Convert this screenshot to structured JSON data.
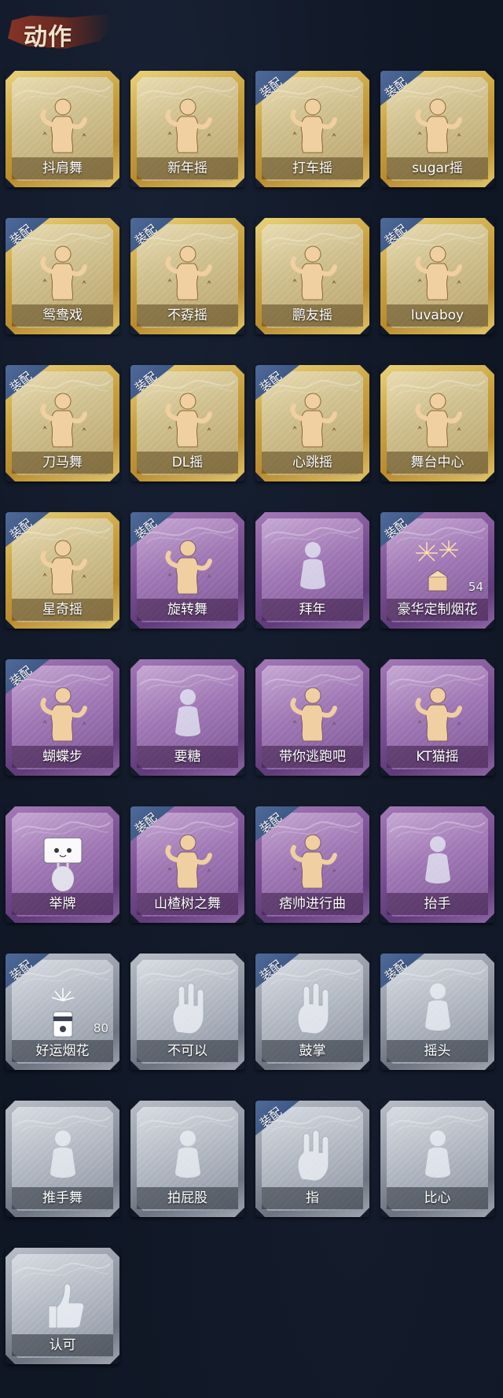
{
  "header": {
    "title": "动作"
  },
  "badge_label": "装配",
  "cards": [
    {
      "label": "抖肩舞",
      "tier": "gold",
      "equipped": false,
      "icon": "dance-figure-icon"
    },
    {
      "label": "新年摇",
      "tier": "gold",
      "equipped": false,
      "icon": "dance-figure-icon"
    },
    {
      "label": "打车摇",
      "tier": "gold",
      "equipped": true,
      "icon": "dance-figure-icon"
    },
    {
      "label": "sugar摇",
      "tier": "gold",
      "equipped": true,
      "icon": "dance-figure-icon"
    },
    {
      "label": "鸳鸯戏",
      "tier": "gold",
      "equipped": true,
      "icon": "dance-figure-icon"
    },
    {
      "label": "不孬摇",
      "tier": "gold",
      "equipped": true,
      "icon": "dance-figure-icon"
    },
    {
      "label": "鹏友摇",
      "tier": "gold",
      "equipped": false,
      "icon": "dance-figure-icon"
    },
    {
      "label": "luvaboy",
      "tier": "gold",
      "equipped": true,
      "icon": "dance-figure-icon"
    },
    {
      "label": "刀马舞",
      "tier": "gold",
      "equipped": true,
      "icon": "dance-figure-icon"
    },
    {
      "label": "DL摇",
      "tier": "gold",
      "equipped": true,
      "icon": "dance-figure-icon"
    },
    {
      "label": "心跳摇",
      "tier": "gold",
      "equipped": true,
      "icon": "dance-figure-icon"
    },
    {
      "label": "舞台中心",
      "tier": "gold",
      "equipped": false,
      "icon": "dance-figure-icon"
    },
    {
      "label": "星奇摇",
      "tier": "gold",
      "equipped": true,
      "icon": "dance-figure-icon"
    },
    {
      "label": "旋转舞",
      "tier": "purple",
      "equipped": true,
      "icon": "dance-figure-icon"
    },
    {
      "label": "拜年",
      "tier": "purple",
      "equipped": false,
      "icon": "bow-figure-icon"
    },
    {
      "label": "豪华定制烟花",
      "tier": "purple",
      "equipped": true,
      "icon": "fireworks-box-icon",
      "count": "54"
    },
    {
      "label": "蝴蝶步",
      "tier": "purple",
      "equipped": true,
      "icon": "dance-figure-icon"
    },
    {
      "label": "要糖",
      "tier": "purple",
      "equipped": false,
      "icon": "bow-figure-icon"
    },
    {
      "label": "带你逃跑吧",
      "tier": "purple",
      "equipped": false,
      "icon": "dance-figure-icon"
    },
    {
      "label": "KT猫摇",
      "tier": "purple",
      "equipped": false,
      "icon": "dance-figure-icon"
    },
    {
      "label": "举牌",
      "tier": "purple",
      "equipped": false,
      "icon": "sign-icon"
    },
    {
      "label": "山楂树之舞",
      "tier": "purple",
      "equipped": true,
      "icon": "dance-figure-icon"
    },
    {
      "label": "痞帅进行曲",
      "tier": "purple",
      "equipped": true,
      "icon": "dance-figure-icon"
    },
    {
      "label": "抬手",
      "tier": "purple",
      "equipped": false,
      "icon": "bow-figure-icon"
    },
    {
      "label": "好运烟花",
      "tier": "gray",
      "equipped": true,
      "icon": "firework-can-icon",
      "count": "80"
    },
    {
      "label": "不可以",
      "tier": "gray",
      "equipped": false,
      "icon": "hand-icon"
    },
    {
      "label": "鼓掌",
      "tier": "gray",
      "equipped": true,
      "icon": "hand-icon"
    },
    {
      "label": "摇头",
      "tier": "gray",
      "equipped": true,
      "icon": "bow-figure-icon"
    },
    {
      "label": "推手舞",
      "tier": "gray",
      "equipped": false,
      "icon": "bow-figure-icon"
    },
    {
      "label": "拍屁股",
      "tier": "gray",
      "equipped": false,
      "icon": "bow-figure-icon"
    },
    {
      "label": "指",
      "tier": "gray",
      "equipped": true,
      "icon": "hand-icon"
    },
    {
      "label": "比心",
      "tier": "gray",
      "equipped": false,
      "icon": "bow-figure-icon"
    },
    {
      "label": "认可",
      "tier": "gray",
      "equipped": false,
      "icon": "thumbs-up-icon"
    }
  ]
}
